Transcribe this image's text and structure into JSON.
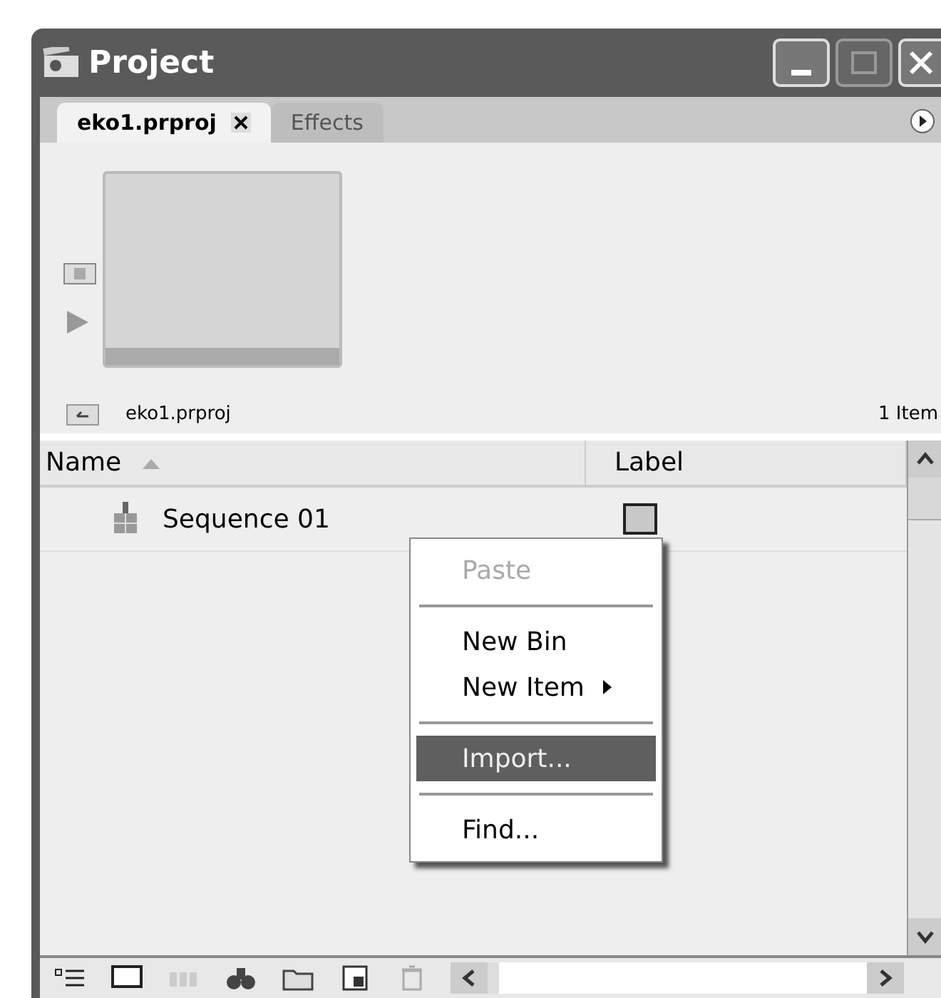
{
  "window": {
    "title": "Project"
  },
  "tabs": [
    {
      "label": "eko1.prproj",
      "selected": true,
      "closable": true
    },
    {
      "label": "Effects",
      "selected": false,
      "closable": false
    }
  ],
  "path": {
    "label": "eko1.prproj",
    "count": "1 Item"
  },
  "table": {
    "columns": [
      "Name",
      "Label"
    ],
    "rows": [
      {
        "name": "Sequence 01",
        "color": "#c8c8c8"
      }
    ]
  },
  "context_menu": [
    {
      "kind": "item",
      "label": "Paste",
      "disabled": true,
      "selected": false,
      "submenu": false
    },
    {
      "kind": "separator"
    },
    {
      "kind": "item",
      "label": "New Bin",
      "disabled": false,
      "selected": false,
      "submenu": false
    },
    {
      "kind": "item",
      "label": "New Item",
      "disabled": false,
      "selected": false,
      "submenu": true
    },
    {
      "kind": "separator"
    },
    {
      "kind": "item",
      "label": "Import...",
      "disabled": false,
      "selected": true,
      "submenu": false
    },
    {
      "kind": "separator"
    },
    {
      "kind": "item",
      "label": "Find...",
      "disabled": false,
      "selected": false,
      "submenu": false
    }
  ]
}
